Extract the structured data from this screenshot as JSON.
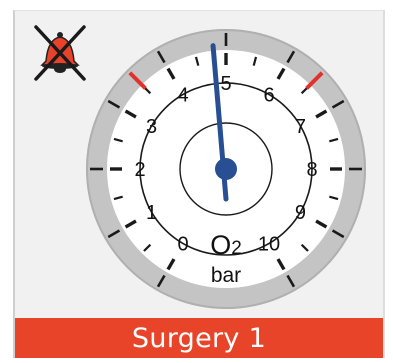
{
  "gauge": {
    "gas_label": "O",
    "gas_subscript": "2",
    "unit": "bar",
    "min": 0,
    "max": 10,
    "reading": 5,
    "tick_labels": [
      "0",
      "1",
      "2",
      "3",
      "4",
      "5",
      "6",
      "7",
      "8",
      "9",
      "10"
    ],
    "alarm_limits": [
      3.5,
      6.5
    ],
    "needle_color": "#284f93",
    "alarm_mark_color": "#e0322b"
  },
  "alarm": {
    "icon": "alarm-bell-muted-icon",
    "bell_color": "#e8432a"
  },
  "banner": {
    "label": "Surgery 1",
    "color": "#e8442a"
  }
}
